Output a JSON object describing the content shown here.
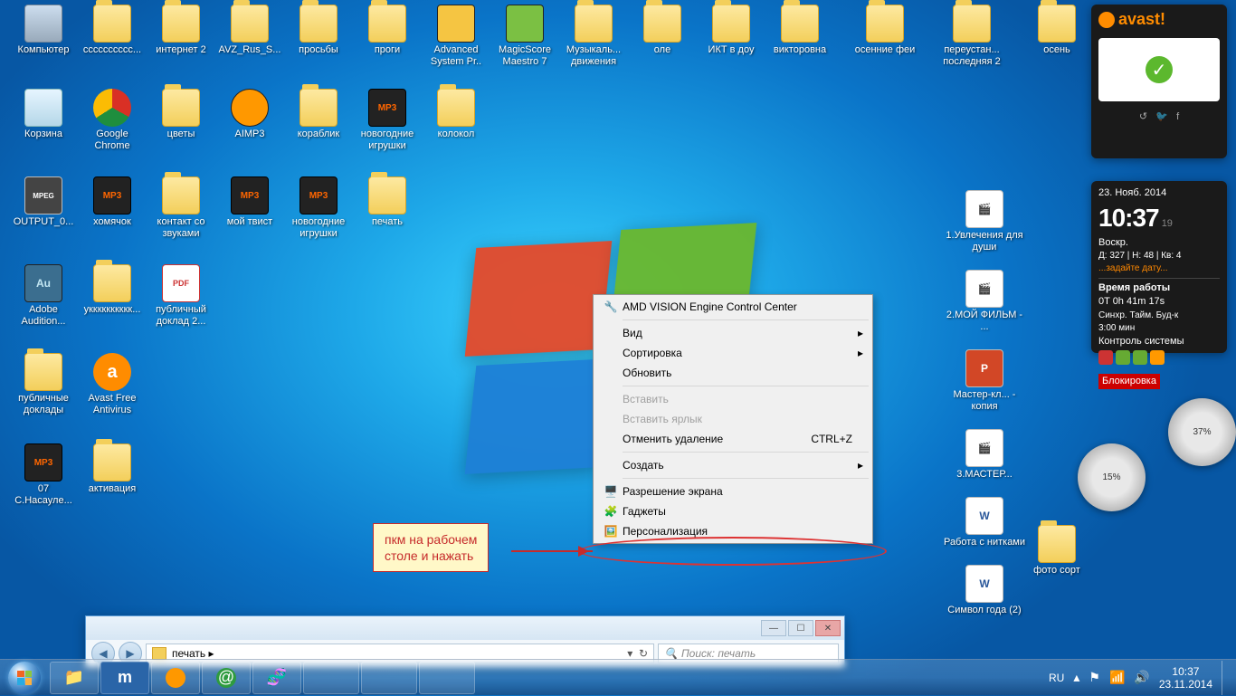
{
  "gadgets": {
    "avast": {
      "brand": "avast!"
    },
    "clock": {
      "date": "23. Нояб. 2014",
      "time": "10:37",
      "seconds": "19",
      "dow": "Воскр.",
      "row1": "Д: 327 |  Н: 48  |  Кв: 4",
      "row2": "...задайте дату...",
      "uptime_label": "Время работы",
      "uptime": "0T 0h 41m 17s",
      "sync": "Синхр.  Тайм.  Буд-к",
      "sync2": "3:00 мин",
      "ctrl": "Контроль системы",
      "block": "Блокировка"
    },
    "cpu": {
      "val": "37%"
    },
    "ram": {
      "val": "15%"
    }
  },
  "icons": {
    "computer": "Компьютер",
    "sss": "сссссссссс...",
    "internet2": "интернет 2",
    "avz": "AVZ_Rus_S...",
    "prosby": "просьбы",
    "progi": "проги",
    "asp": "Advanced System Pr..",
    "magicscore": "MagicScore Maestro 7",
    "muzyk": "Музыкаль... движения",
    "ole": "оле",
    "ikt": "ИКТ в доу",
    "viktor": "викторовна",
    "osfei": "осенние феи",
    "pereust": "переустан... последняя 2",
    "osen": "осень",
    "bin": "Корзина",
    "chrome": "Google Chrome",
    "cvety": "цветы",
    "aimp": "AIMP3",
    "korablik": "кораблик",
    "ng_toys": "новогодние игрушки",
    "kolokol": "колокол",
    "output": "OUTPUT_0...",
    "homyak": "хомячок",
    "kontakt": "контакт со звуками",
    "moitvist": "мой твист",
    "ng_toys2": "новогодние игрушки",
    "pechat": "печать",
    "au": "Adobe Audition...",
    "ukk": "укккккккккк...",
    "doklad": "публичный доклад 2...",
    "pubdok": "публичные доклады",
    "avastfree": "Avast Free Antivirus",
    "07": "07 С.Насауле...",
    "aktiv": "активация",
    "uvlech": "1.Увлечения для души",
    "moifilm": "2.МОЙ ФИЛЬМ - ...",
    "master": "Мастер-кл... - копия",
    "master3": "3.МАСТЕР...",
    "rabota": "Работа с нитками",
    "simvol": "Символ года (2)",
    "fotosort": "фото сорт"
  },
  "context_menu": {
    "amd": "AMD VISION Engine Control Center",
    "view": "Вид",
    "sort": "Сортировка",
    "refresh": "Обновить",
    "paste": "Вставить",
    "paste_sc": "Вставить ярлык",
    "undo": "Отменить удаление",
    "undo_sc": "CTRL+Z",
    "new": "Создать",
    "resolution": "Разрешение экрана",
    "gadgets": "Гаджеты",
    "personalize": "Персонализация"
  },
  "callout": {
    "line1": "пкм на рабочем",
    "line2": "столе и нажать"
  },
  "explorer": {
    "breadcrumb": "печать",
    "bread_arrow": "▸",
    "search_placeholder": "Поиск: печать"
  },
  "taskbar": {
    "lang": "RU",
    "time": "10:37",
    "date": "23.11.2014"
  }
}
